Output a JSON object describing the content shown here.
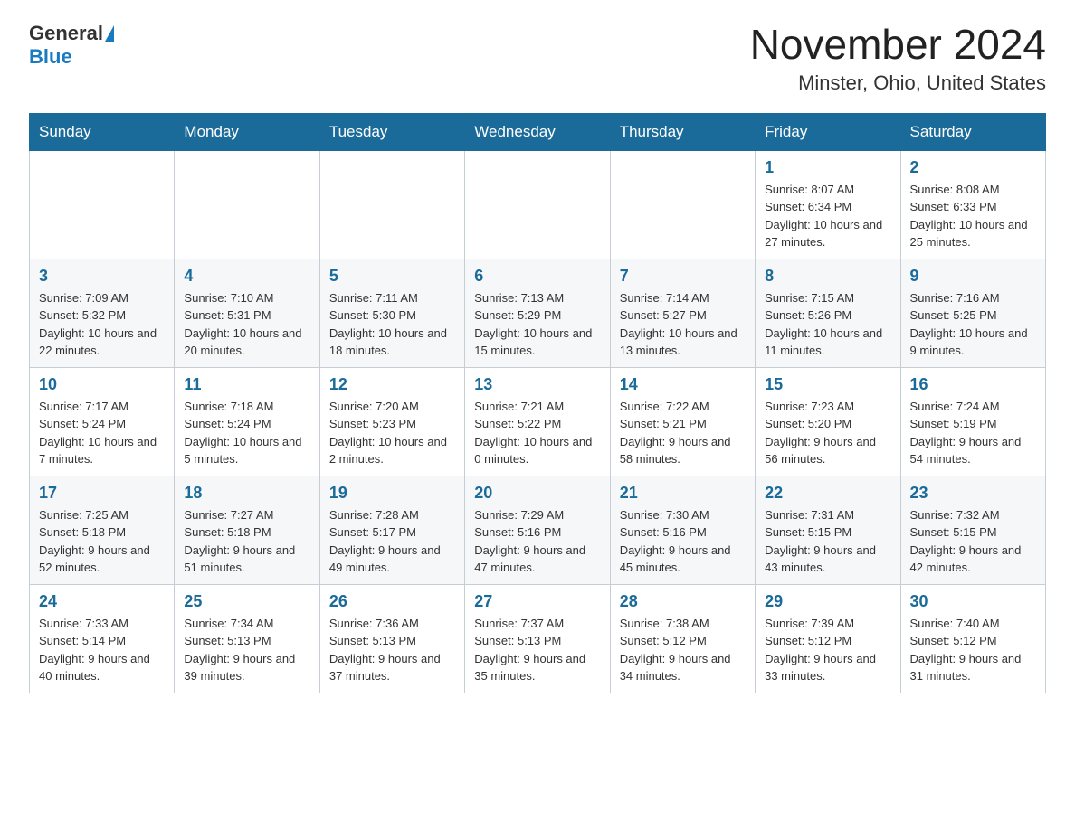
{
  "header": {
    "logo_general": "General",
    "logo_blue": "Blue",
    "month_title": "November 2024",
    "location": "Minster, Ohio, United States"
  },
  "days_of_week": [
    "Sunday",
    "Monday",
    "Tuesday",
    "Wednesday",
    "Thursday",
    "Friday",
    "Saturday"
  ],
  "weeks": [
    {
      "days": [
        {
          "number": "",
          "info": ""
        },
        {
          "number": "",
          "info": ""
        },
        {
          "number": "",
          "info": ""
        },
        {
          "number": "",
          "info": ""
        },
        {
          "number": "",
          "info": ""
        },
        {
          "number": "1",
          "info": "Sunrise: 8:07 AM\nSunset: 6:34 PM\nDaylight: 10 hours and 27 minutes."
        },
        {
          "number": "2",
          "info": "Sunrise: 8:08 AM\nSunset: 6:33 PM\nDaylight: 10 hours and 25 minutes."
        }
      ]
    },
    {
      "days": [
        {
          "number": "3",
          "info": "Sunrise: 7:09 AM\nSunset: 5:32 PM\nDaylight: 10 hours and 22 minutes."
        },
        {
          "number": "4",
          "info": "Sunrise: 7:10 AM\nSunset: 5:31 PM\nDaylight: 10 hours and 20 minutes."
        },
        {
          "number": "5",
          "info": "Sunrise: 7:11 AM\nSunset: 5:30 PM\nDaylight: 10 hours and 18 minutes."
        },
        {
          "number": "6",
          "info": "Sunrise: 7:13 AM\nSunset: 5:29 PM\nDaylight: 10 hours and 15 minutes."
        },
        {
          "number": "7",
          "info": "Sunrise: 7:14 AM\nSunset: 5:27 PM\nDaylight: 10 hours and 13 minutes."
        },
        {
          "number": "8",
          "info": "Sunrise: 7:15 AM\nSunset: 5:26 PM\nDaylight: 10 hours and 11 minutes."
        },
        {
          "number": "9",
          "info": "Sunrise: 7:16 AM\nSunset: 5:25 PM\nDaylight: 10 hours and 9 minutes."
        }
      ]
    },
    {
      "days": [
        {
          "number": "10",
          "info": "Sunrise: 7:17 AM\nSunset: 5:24 PM\nDaylight: 10 hours and 7 minutes."
        },
        {
          "number": "11",
          "info": "Sunrise: 7:18 AM\nSunset: 5:24 PM\nDaylight: 10 hours and 5 minutes."
        },
        {
          "number": "12",
          "info": "Sunrise: 7:20 AM\nSunset: 5:23 PM\nDaylight: 10 hours and 2 minutes."
        },
        {
          "number": "13",
          "info": "Sunrise: 7:21 AM\nSunset: 5:22 PM\nDaylight: 10 hours and 0 minutes."
        },
        {
          "number": "14",
          "info": "Sunrise: 7:22 AM\nSunset: 5:21 PM\nDaylight: 9 hours and 58 minutes."
        },
        {
          "number": "15",
          "info": "Sunrise: 7:23 AM\nSunset: 5:20 PM\nDaylight: 9 hours and 56 minutes."
        },
        {
          "number": "16",
          "info": "Sunrise: 7:24 AM\nSunset: 5:19 PM\nDaylight: 9 hours and 54 minutes."
        }
      ]
    },
    {
      "days": [
        {
          "number": "17",
          "info": "Sunrise: 7:25 AM\nSunset: 5:18 PM\nDaylight: 9 hours and 52 minutes."
        },
        {
          "number": "18",
          "info": "Sunrise: 7:27 AM\nSunset: 5:18 PM\nDaylight: 9 hours and 51 minutes."
        },
        {
          "number": "19",
          "info": "Sunrise: 7:28 AM\nSunset: 5:17 PM\nDaylight: 9 hours and 49 minutes."
        },
        {
          "number": "20",
          "info": "Sunrise: 7:29 AM\nSunset: 5:16 PM\nDaylight: 9 hours and 47 minutes."
        },
        {
          "number": "21",
          "info": "Sunrise: 7:30 AM\nSunset: 5:16 PM\nDaylight: 9 hours and 45 minutes."
        },
        {
          "number": "22",
          "info": "Sunrise: 7:31 AM\nSunset: 5:15 PM\nDaylight: 9 hours and 43 minutes."
        },
        {
          "number": "23",
          "info": "Sunrise: 7:32 AM\nSunset: 5:15 PM\nDaylight: 9 hours and 42 minutes."
        }
      ]
    },
    {
      "days": [
        {
          "number": "24",
          "info": "Sunrise: 7:33 AM\nSunset: 5:14 PM\nDaylight: 9 hours and 40 minutes."
        },
        {
          "number": "25",
          "info": "Sunrise: 7:34 AM\nSunset: 5:13 PM\nDaylight: 9 hours and 39 minutes."
        },
        {
          "number": "26",
          "info": "Sunrise: 7:36 AM\nSunset: 5:13 PM\nDaylight: 9 hours and 37 minutes."
        },
        {
          "number": "27",
          "info": "Sunrise: 7:37 AM\nSunset: 5:13 PM\nDaylight: 9 hours and 35 minutes."
        },
        {
          "number": "28",
          "info": "Sunrise: 7:38 AM\nSunset: 5:12 PM\nDaylight: 9 hours and 34 minutes."
        },
        {
          "number": "29",
          "info": "Sunrise: 7:39 AM\nSunset: 5:12 PM\nDaylight: 9 hours and 33 minutes."
        },
        {
          "number": "30",
          "info": "Sunrise: 7:40 AM\nSunset: 5:12 PM\nDaylight: 9 hours and 31 minutes."
        }
      ]
    }
  ]
}
